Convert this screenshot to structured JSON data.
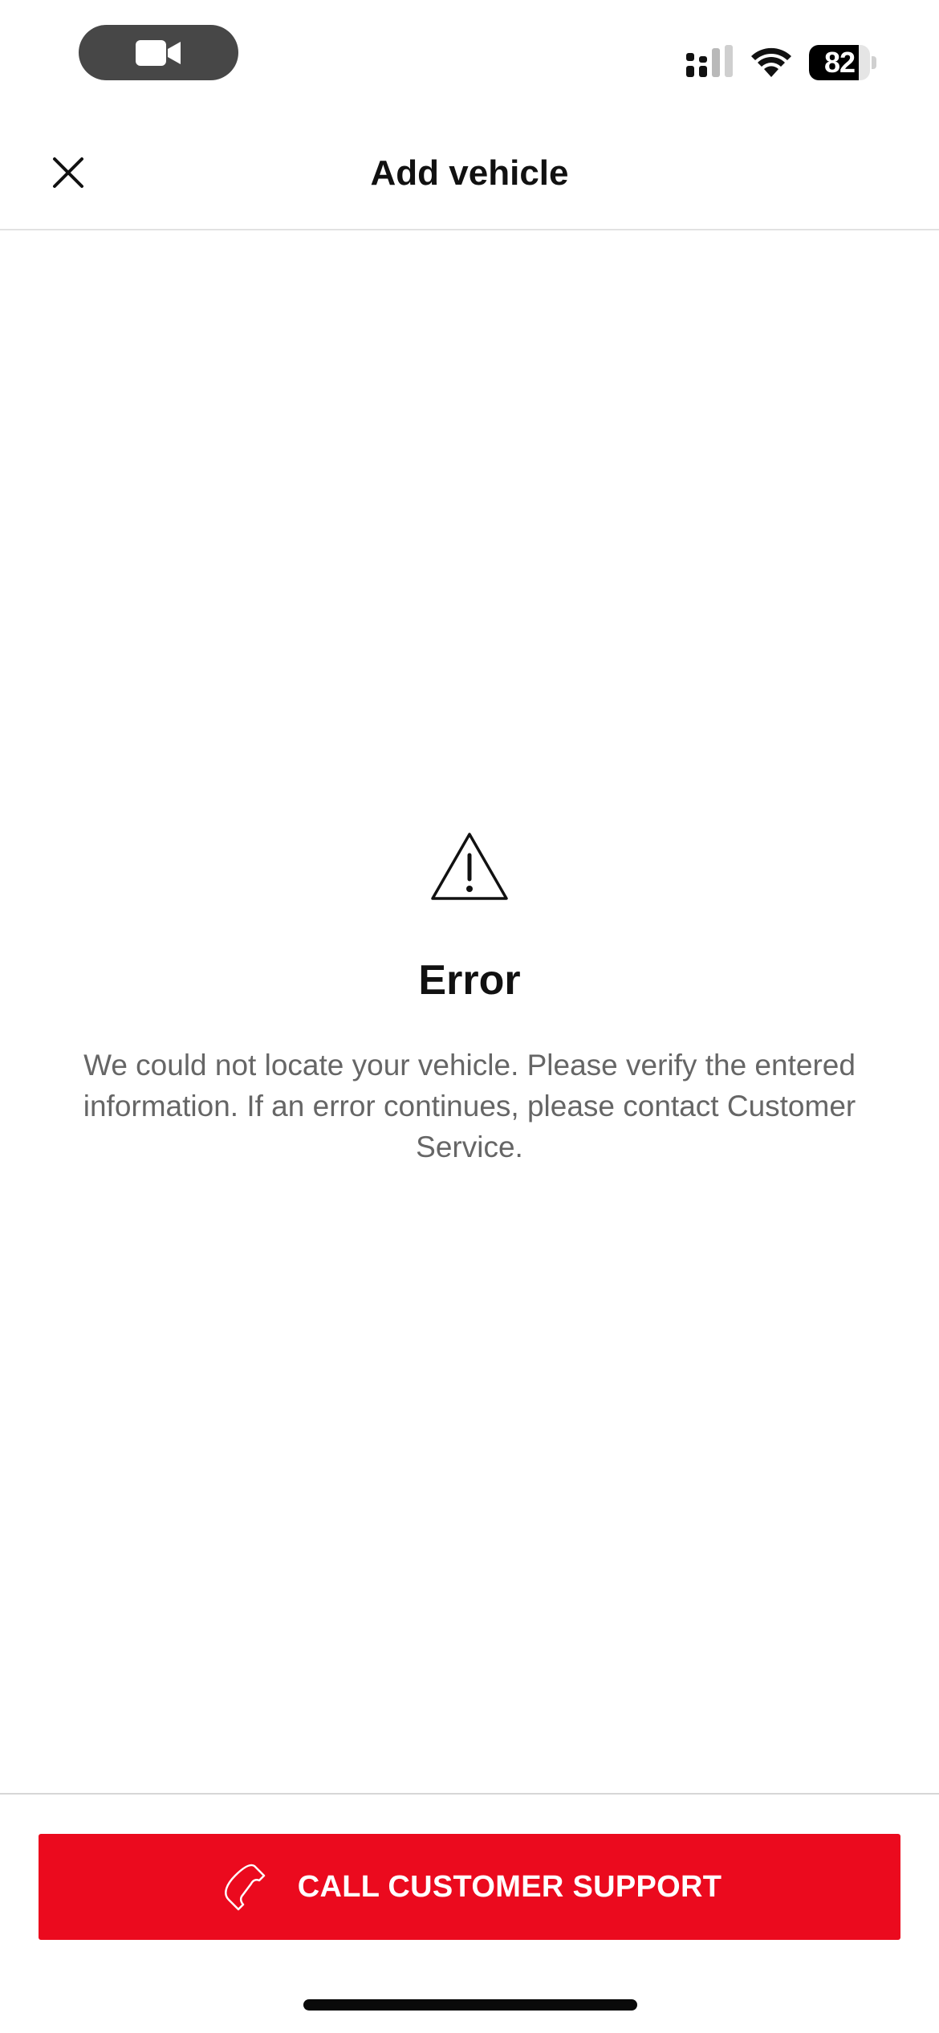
{
  "status_bar": {
    "battery_level": "82",
    "battery_fraction": 0.82,
    "icons": [
      "facetime-video-icon",
      "cellular-signal-icon",
      "wifi-icon",
      "battery-icon"
    ]
  },
  "header": {
    "title": "Add vehicle",
    "close_icon": "close-icon"
  },
  "error": {
    "icon": "warning-triangle-icon",
    "title": "Error",
    "message": "We could not locate your vehicle. Please verify the entered information. If an error continues, please contact Customer Service."
  },
  "footer": {
    "cta_label": "CALL CUSTOMER SUPPORT",
    "cta_icon": "phone-icon"
  },
  "colors": {
    "accent": "#eb0a1e",
    "text_primary": "#111111",
    "text_secondary": "#666666",
    "divider": "#e2e2e2"
  }
}
